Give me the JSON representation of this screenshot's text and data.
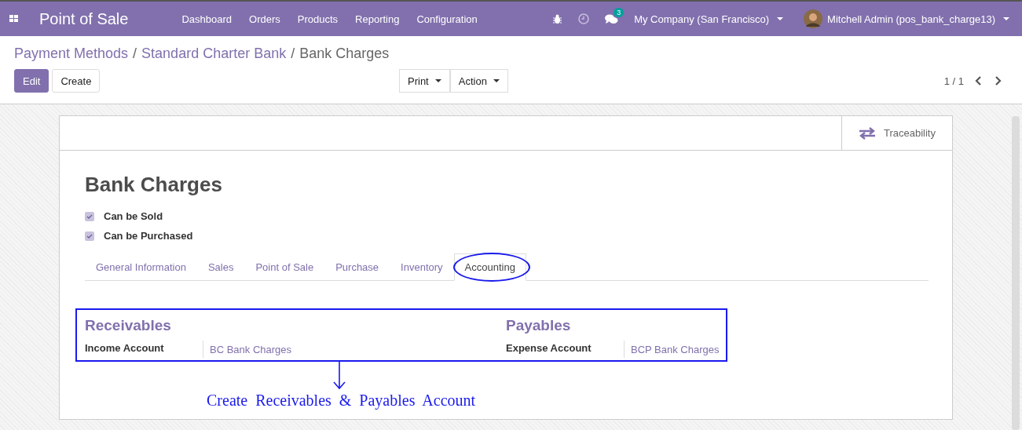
{
  "navbar": {
    "app_title": "Point of Sale",
    "menu": [
      "Dashboard",
      "Orders",
      "Products",
      "Reporting",
      "Configuration"
    ],
    "message_count": "3",
    "company": "My Company (San Francisco)",
    "user": "Mitchell Admin (pos_bank_charge13)"
  },
  "breadcrumb": [
    {
      "label": "Payment Methods",
      "link": true
    },
    {
      "separator": "/",
      "label": "Standard Charter Bank",
      "link": true
    },
    {
      "separator": "/",
      "label": "Bank Charges",
      "link": false
    }
  ],
  "buttons": {
    "edit": "Edit",
    "create": "Create",
    "print": "Print",
    "action": "Action"
  },
  "pager": "1 / 1",
  "sheet": {
    "smart_button": "Traceability",
    "title": "Bank Charges",
    "checkboxes": [
      {
        "label": "Can be Sold",
        "checked": true
      },
      {
        "label": "Can be Purchased",
        "checked": true
      }
    ],
    "tabs": [
      {
        "label": "General Information",
        "selected": false
      },
      {
        "label": "Sales",
        "selected": false
      },
      {
        "label": "Point of Sale",
        "selected": false
      },
      {
        "label": "Purchase",
        "selected": false
      },
      {
        "label": "Inventory",
        "selected": false
      },
      {
        "label": "Accounting",
        "selected": true
      }
    ],
    "groups": [
      {
        "heading": "Receivables",
        "field": "Income Account",
        "value": "BC Bank Charges"
      },
      {
        "heading": "Payables",
        "field": "Expense Account",
        "value": "BCP Bank Charges"
      }
    ]
  },
  "annotation": "Create  Receivables  &  Payables  Account"
}
